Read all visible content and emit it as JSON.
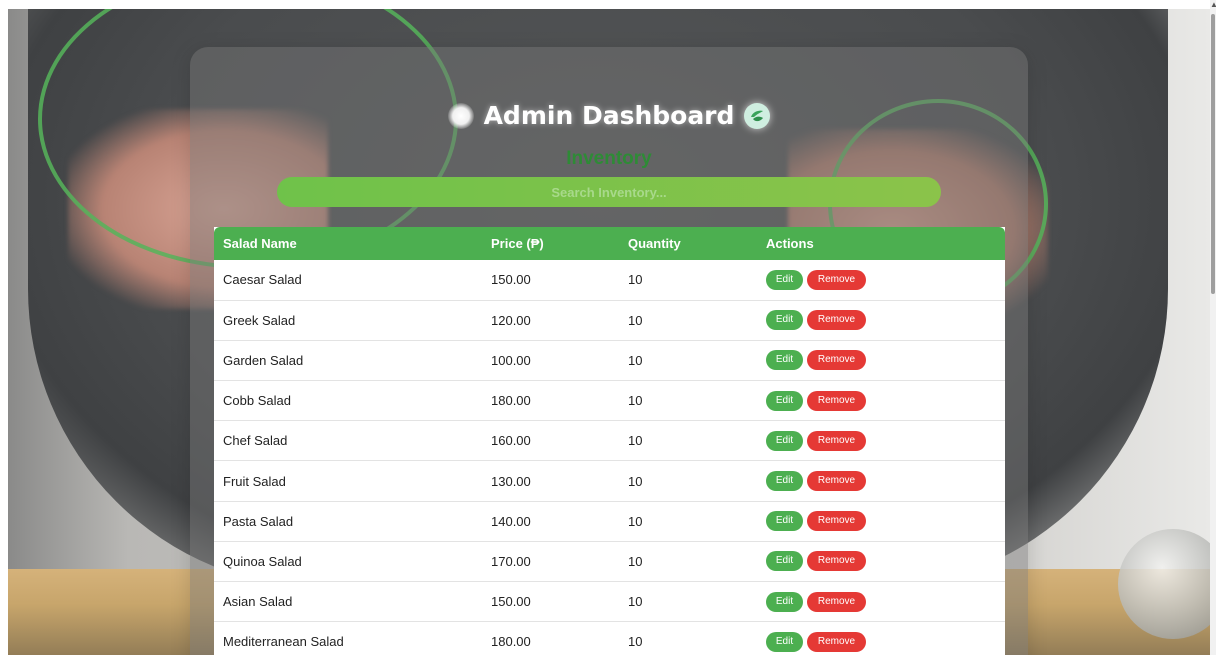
{
  "header": {
    "title": "Admin Dashboard",
    "subtitle": "Inventory"
  },
  "search": {
    "placeholder": "Search Inventory..."
  },
  "table": {
    "columns": [
      "Salad Name",
      "Price (₱)",
      "Quantity",
      "Actions"
    ],
    "edit_label": "Edit",
    "remove_label": "Remove",
    "rows": [
      {
        "name": "Caesar Salad",
        "price": "150.00",
        "quantity": "10"
      },
      {
        "name": "Greek Salad",
        "price": "120.00",
        "quantity": "10"
      },
      {
        "name": "Garden Salad",
        "price": "100.00",
        "quantity": "10"
      },
      {
        "name": "Cobb Salad",
        "price": "180.00",
        "quantity": "10"
      },
      {
        "name": "Chef Salad",
        "price": "160.00",
        "quantity": "10"
      },
      {
        "name": "Fruit Salad",
        "price": "130.00",
        "quantity": "10"
      },
      {
        "name": "Pasta Salad",
        "price": "140.00",
        "quantity": "10"
      },
      {
        "name": "Quinoa Salad",
        "price": "170.00",
        "quantity": "10"
      },
      {
        "name": "Asian Salad",
        "price": "150.00",
        "quantity": "10"
      },
      {
        "name": "Mediterranean Salad",
        "price": "180.00",
        "quantity": "10"
      }
    ]
  },
  "colors": {
    "accent": "#4caf50",
    "remove": "#e53935",
    "subtitle": "#2e8b36"
  },
  "icons": {
    "title_left": "glow-dot-icon",
    "title_right": "leaf-icon"
  }
}
